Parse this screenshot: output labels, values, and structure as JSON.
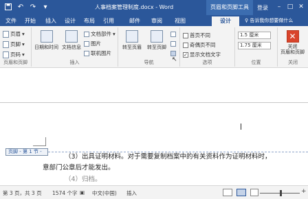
{
  "titlebar": {
    "title": "人事档案管理制度.docx - Word",
    "context_tab_title": "页眉和页脚工具",
    "login": "登录",
    "save_icon": "save-icon",
    "undo_icon": "undo-icon",
    "redo_icon": "redo-icon"
  },
  "tabs": [
    "文件",
    "开始",
    "插入",
    "设计",
    "布局",
    "引用",
    "邮件",
    "审阅",
    "视图",
    "设计"
  ],
  "tellme": "♀ 告诉我你想要做什么",
  "ribbon": {
    "groups": {
      "header_footer": {
        "label": "页眉和页脚",
        "items": [
          "页眉",
          "页脚",
          "页码"
        ]
      },
      "insert": {
        "label": "插入",
        "datetime": "日期和时间",
        "docinfo": "文档信息",
        "quickparts": "文档部件",
        "picture": "图片",
        "online_picture": "联机图片"
      },
      "navigation": {
        "label": "导航",
        "goto_header": "转至页眉",
        "goto_footer": "转至页脚"
      },
      "options": {
        "label": "选项",
        "first_page": "首页不同",
        "odd_even": "奇偶页不同",
        "show_doc_text": "显示文档文字"
      },
      "position": {
        "label": "位置",
        "header_top": "1.5 厘米",
        "footer_bottom": "1.75 厘米"
      },
      "close": {
        "label": "关闭",
        "close_btn": "关闭\n页眉和页脚"
      }
    }
  },
  "document": {
    "footer_tag": "页脚 - 第 1 节 -",
    "paragraph_line1": "（3）出具证明材料。对于需要复制档案中的有关资料作为证明材料时，",
    "paragraph_line2": "意部门公章后才能发出。",
    "paragraph_line3": "（4）归档。"
  },
  "statusbar": {
    "page": "第 3 页，共 3 页",
    "words": "1574 个字",
    "language": "中文(中国)",
    "mode": "插入"
  }
}
